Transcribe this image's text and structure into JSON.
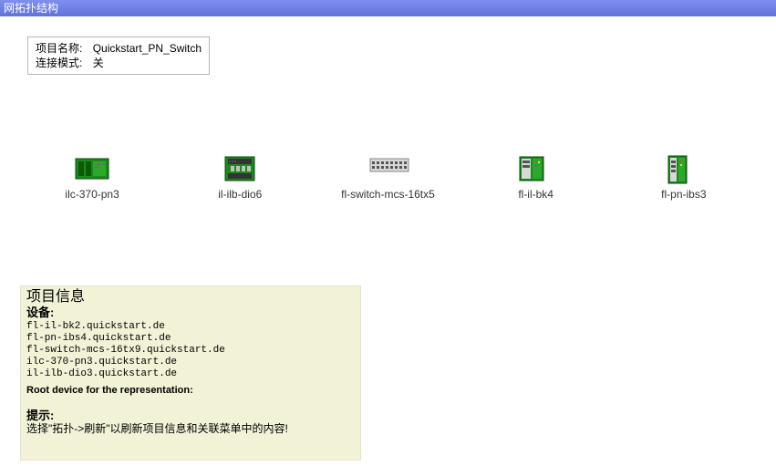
{
  "titlebar": {
    "text": "网拓扑结构"
  },
  "project_box": {
    "name_label": "项目名称:",
    "name_value": "Quickstart_PN_Switch",
    "mode_label": "连接模式:",
    "mode_value": "关"
  },
  "devices": [
    {
      "id": "ilc-370-pn3",
      "label": "ilc-370-pn3",
      "icon": "plc-green"
    },
    {
      "id": "il-ilb-dio6",
      "label": "il-ilb-dio6",
      "icon": "io-block"
    },
    {
      "id": "fl-switch-mcs-16tx5",
      "label": "fl-switch-mcs-16tx5",
      "icon": "switch"
    },
    {
      "id": "fl-il-bk4",
      "label": "fl-il-bk4",
      "icon": "bus-coupler"
    },
    {
      "id": "fl-pn-ibs3",
      "label": "fl-pn-ibs3",
      "icon": "profinet-module"
    }
  ],
  "info_panel": {
    "title": "项目信息",
    "devices_heading": "设备:",
    "device_list": [
      "fl-il-bk2.quickstart.de",
      "fl-pn-ibs4.quickstart.de",
      "fl-switch-mcs-16tx9.quickstart.de",
      "ilc-370-pn3.quickstart.de",
      "il-ilb-dio3.quickstart.de"
    ],
    "root_label": "Root device for the representation:",
    "tip_heading": "提示:",
    "tip_text": "选择\"拓扑->刷新\"以刷新项目信息和关联菜单中的内容!"
  }
}
